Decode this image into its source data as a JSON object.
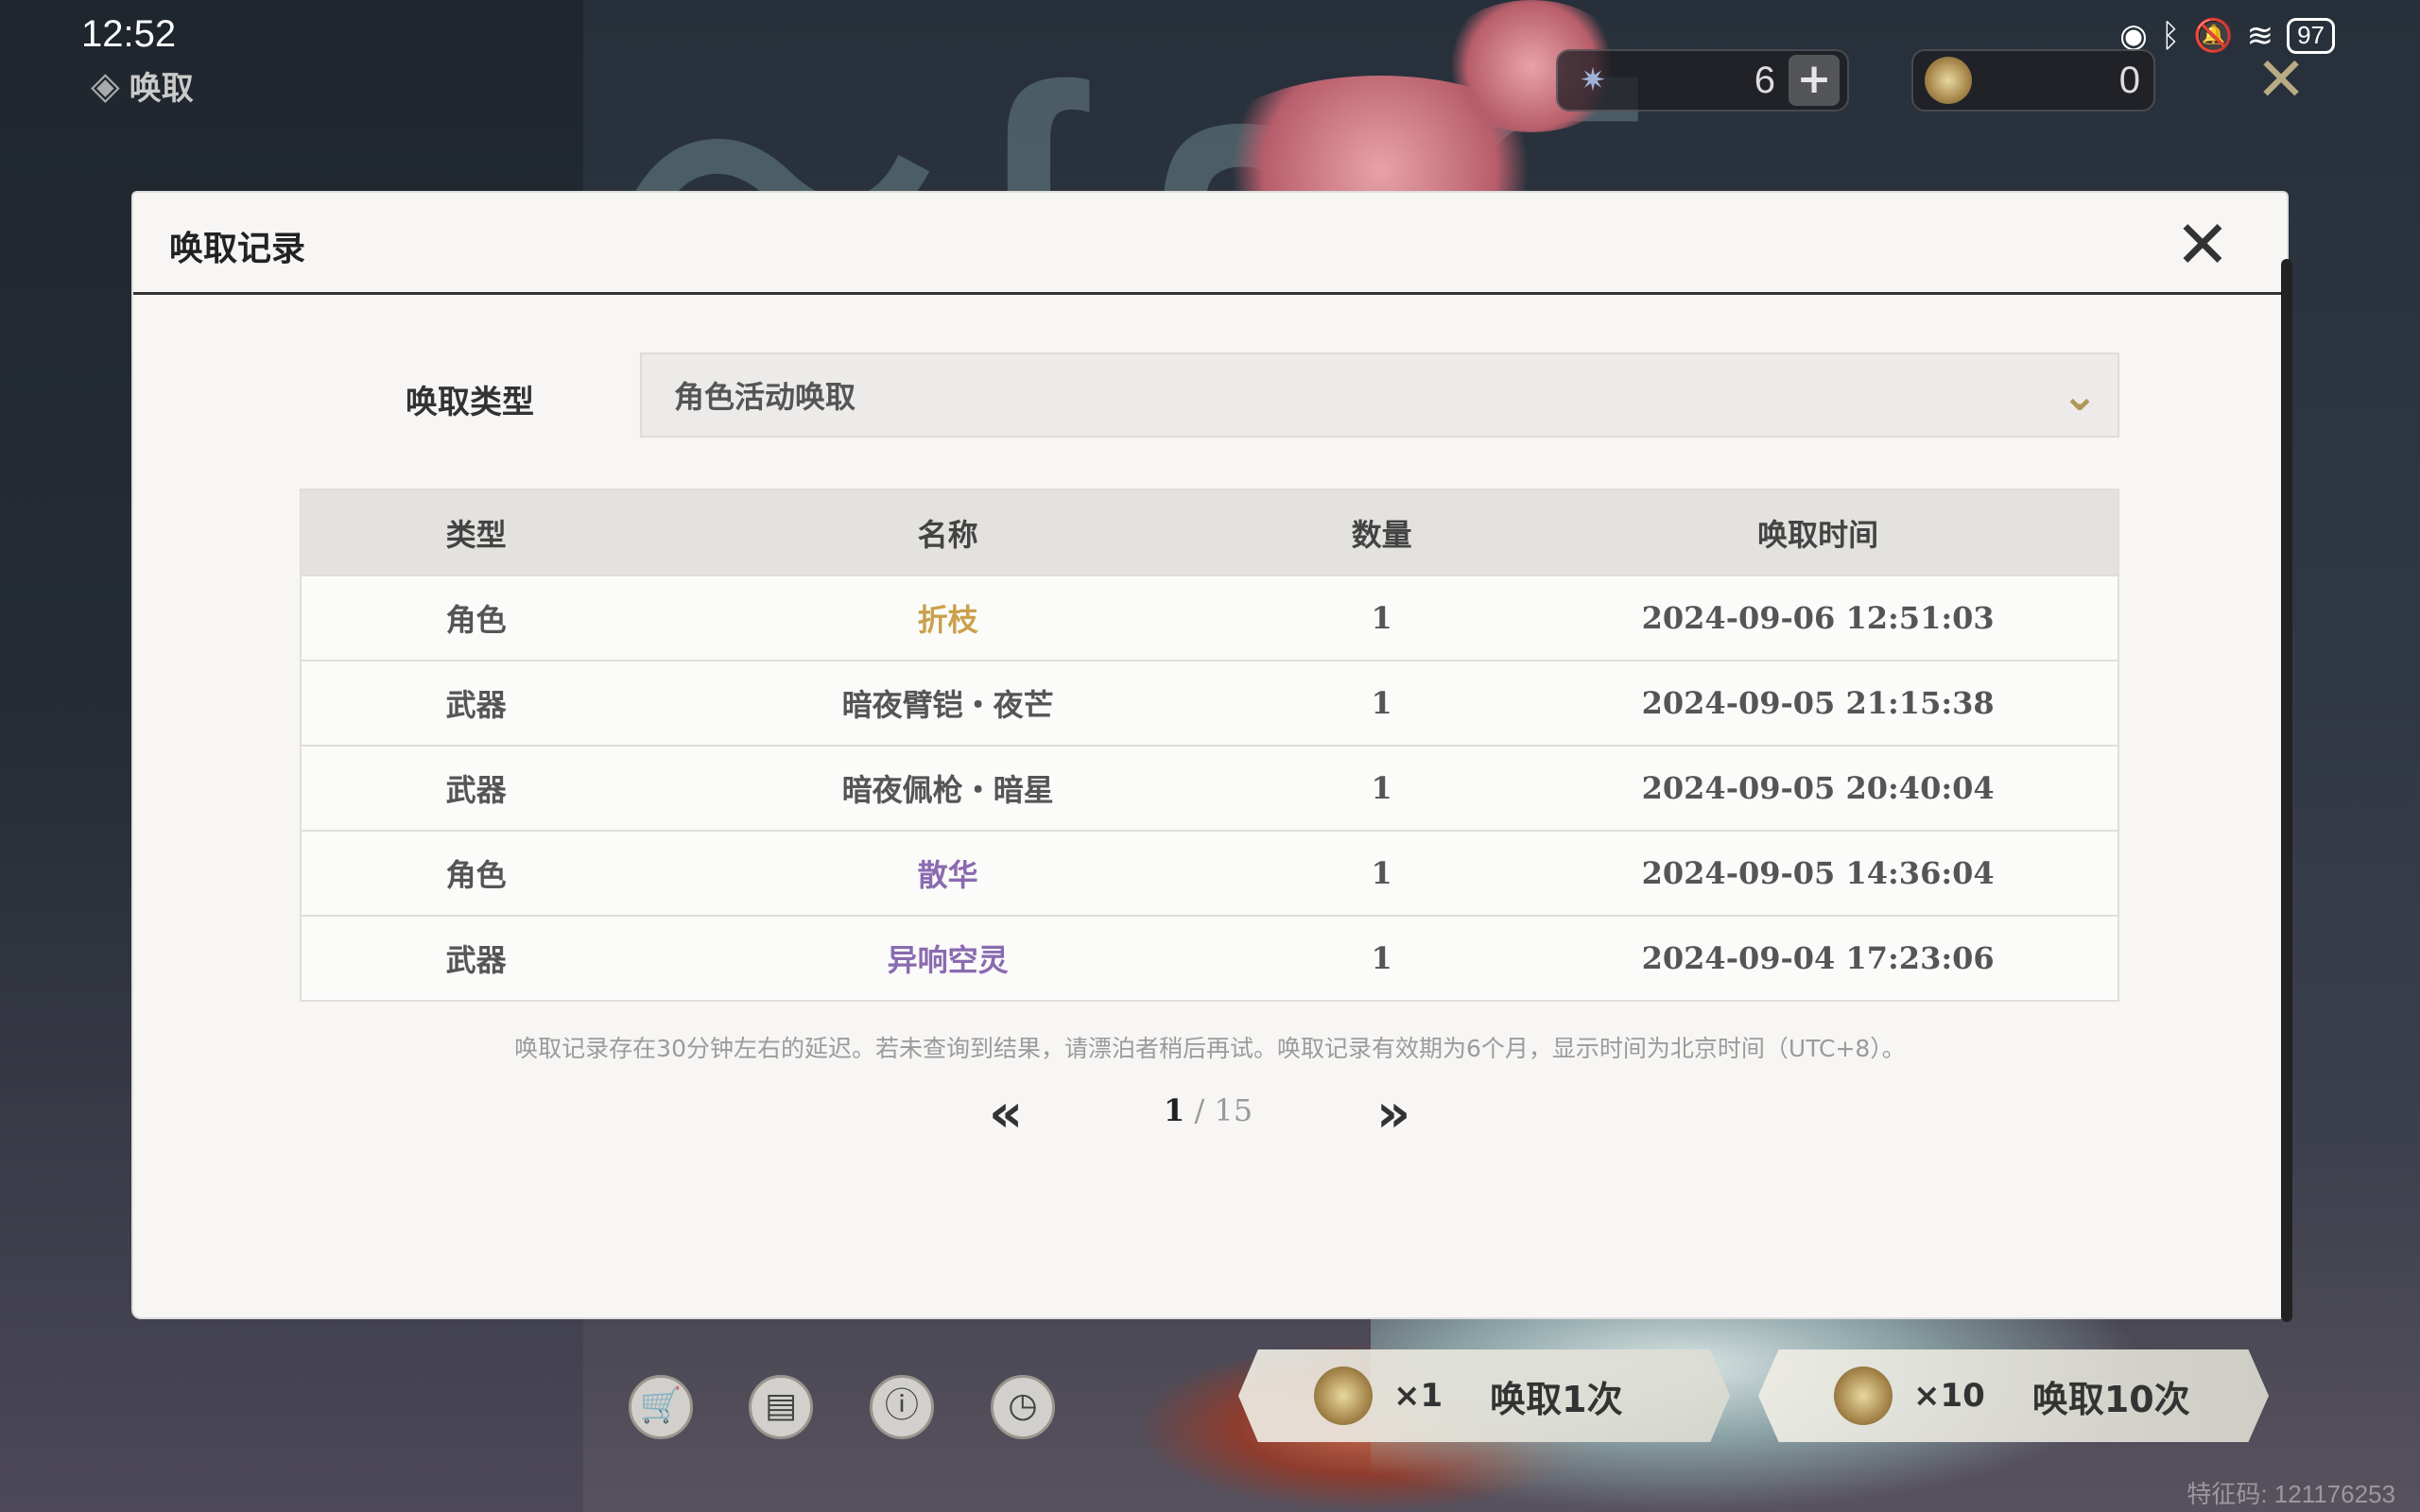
{
  "status_bar": {
    "time": "12:52",
    "battery": "97"
  },
  "app": {
    "title": "唤取"
  },
  "currencies": [
    {
      "icon": "star-crystal-icon",
      "value": "6"
    },
    {
      "icon": "coin-icon",
      "value": "0"
    }
  ],
  "modal": {
    "title": "唤取记录",
    "type_label": "唤取类型",
    "type_value": "角色活动唤取",
    "columns": [
      "类型",
      "名称",
      "数量",
      "唤取时间"
    ],
    "rows": [
      {
        "type": "角色",
        "name": "折枝",
        "qty": "1",
        "time": "2024-09-06 12:51:03",
        "name_color": "#c9a14a"
      },
      {
        "type": "武器",
        "name": "暗夜臂铠・夜芒",
        "qty": "1",
        "time": "2024-09-05 21:15:38",
        "name_color": "#555555"
      },
      {
        "type": "武器",
        "name": "暗夜佩枪・暗星",
        "qty": "1",
        "time": "2024-09-05 20:40:04",
        "name_color": "#555555"
      },
      {
        "type": "角色",
        "name": "散华",
        "qty": "1",
        "time": "2024-09-05 14:36:04",
        "name_color": "#8a6bb0"
      },
      {
        "type": "武器",
        "name": "异响空灵",
        "qty": "1",
        "time": "2024-09-04 17:23:06",
        "name_color": "#8a6bb0"
      }
    ],
    "note": "唤取记录存在30分钟左右的延迟。若未查询到结果，请漂泊者稍后再试。唤取记录有效期为6个月，显示时间为北京时间（UTC+8）。",
    "pager": {
      "current": "1",
      "separator": "/",
      "total": "15"
    }
  },
  "bottom": {
    "pull_once": {
      "mult": "×1",
      "label": "唤取1次"
    },
    "pull_ten": {
      "mult": "×10",
      "label": "唤取10次"
    },
    "watermark": "特征码: 121176253"
  }
}
